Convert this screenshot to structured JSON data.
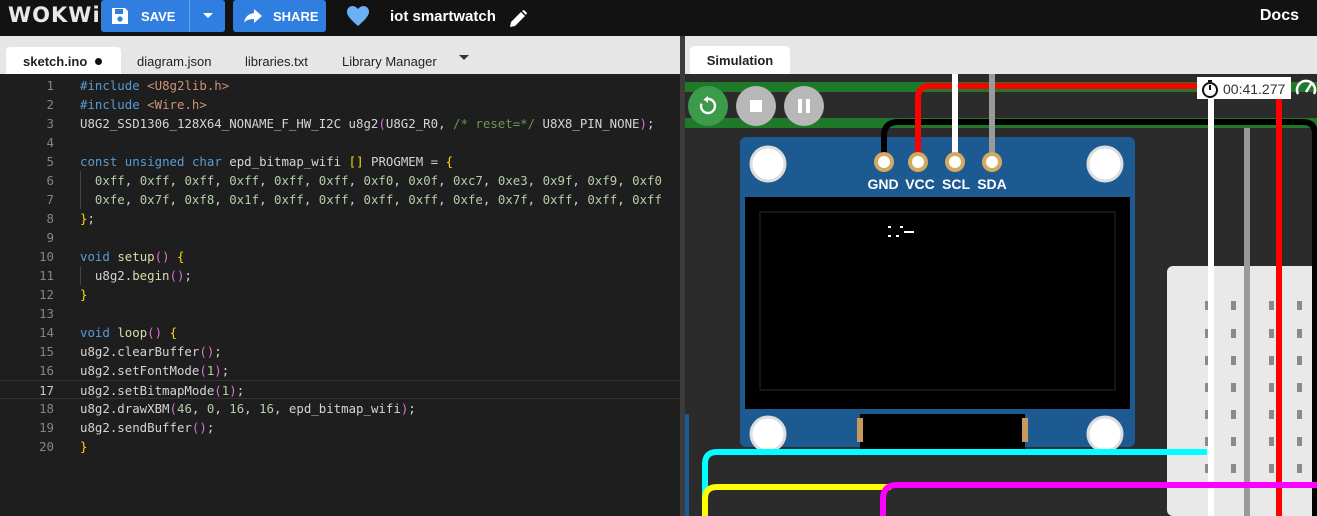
{
  "header": {
    "logo": "WOKWi",
    "save_label": "SAVE",
    "share_label": "SHARE",
    "project_title": "iot smartwatch",
    "docs_label": "Docs"
  },
  "editor": {
    "tabs": [
      {
        "label": "sketch.ino",
        "active": true,
        "modified": true
      },
      {
        "label": "diagram.json"
      },
      {
        "label": "libraries.txt"
      },
      {
        "label": "Library Manager"
      }
    ],
    "current_line": 17,
    "lines": [
      "#include <U8g2lib.h>",
      "#include <Wire.h>",
      "U8G2_SSD1306_128X64_NONAME_F_HW_I2C u8g2(U8G2_R0, /* reset=*/ U8X8_PIN_NONE);",
      "",
      "const unsigned char epd_bitmap_wifi [] PROGMEM = {",
      "  0xff, 0xff, 0xff, 0xff, 0xff, 0xff, 0xf0, 0x0f, 0xc7, 0xe3, 0x9f, 0xf9, 0xf0",
      "  0xfe, 0x7f, 0xf8, 0x1f, 0xff, 0xff, 0xff, 0xff, 0xfe, 0x7f, 0xff, 0xff, 0xff",
      "};",
      "",
      "void setup() {",
      "  u8g2.begin();",
      "}",
      "",
      "void loop() {",
      "u8g2.clearBuffer();",
      "u8g2.setFontMode(1);",
      "u8g2.setBitmapMode(1);",
      "u8g2.drawXBM(46, 0, 16, 16, epd_bitmap_wifi);",
      "u8g2.sendBuffer();",
      "}"
    ]
  },
  "simulation": {
    "tab_label": "Simulation",
    "timer": "00:41.277",
    "oled_pins": [
      "GND",
      "VCC",
      "SCL",
      "SDA"
    ],
    "colors": {
      "accent": "#2f7ee0",
      "restart": "#3c9a4b",
      "board": "#1d5a91",
      "wire_red": "#ff0000",
      "wire_black": "#000000",
      "wire_white": "#ffffff",
      "wire_gray": "#9a9a9a",
      "wire_cyan": "#00ffff",
      "wire_yellow": "#ffff00",
      "wire_magenta": "#ff00ff"
    }
  }
}
